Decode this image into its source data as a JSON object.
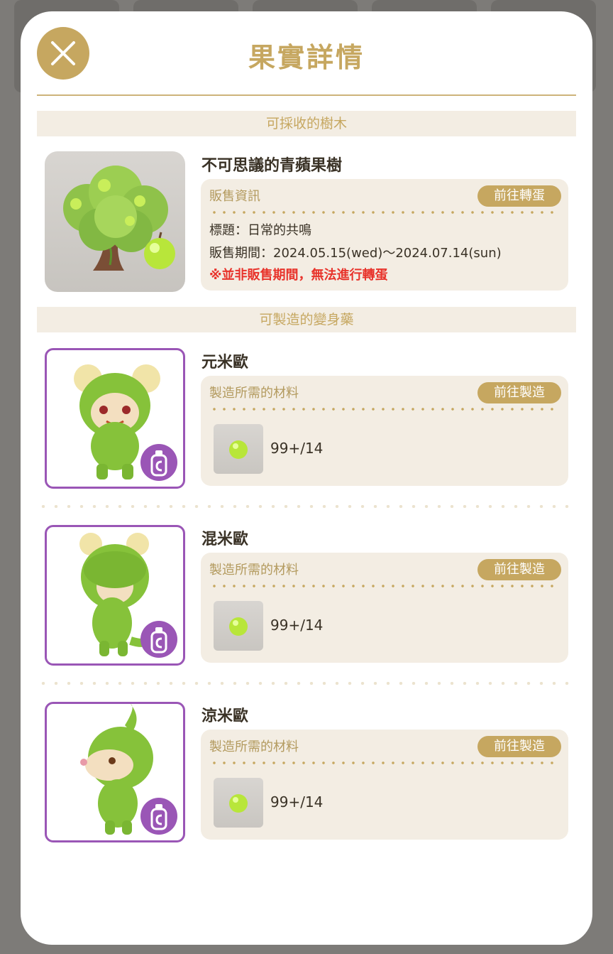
{
  "dialog": {
    "title": "果實詳情"
  },
  "sections": {
    "tree_header": "可採收的樹木",
    "potion_header": "可製造的變身藥"
  },
  "tree": {
    "name": "不可思議的青蘋果樹",
    "info_label": "販售資訊",
    "button": "前往轉蛋",
    "line_title": "標題：日常的共鳴",
    "line_period": "販售期間：2024.05.15(wed)〜2024.07.14(sun)",
    "line_warning": "※並非販售期間，無法進行轉蛋"
  },
  "potions": [
    {
      "name": "元米歐",
      "materials_label": "製造所需的材料",
      "button": "前往製造",
      "quantity": "99+/14"
    },
    {
      "name": "混米歐",
      "materials_label": "製造所需的材料",
      "button": "前往製造",
      "quantity": "99+/14"
    },
    {
      "name": "涼米歐",
      "materials_label": "製造所需的材料",
      "button": "前往製造",
      "quantity": "99+/14"
    }
  ],
  "colors": {
    "accent_gold": "#c6a760",
    "section_bg": "#f3ede3",
    "badge_purple": "#9a56b6",
    "warning_red": "#e8332b"
  },
  "icons": {
    "close": "close-icon",
    "material": "green-apple-icon",
    "badge": "potion-bottle-icon"
  }
}
